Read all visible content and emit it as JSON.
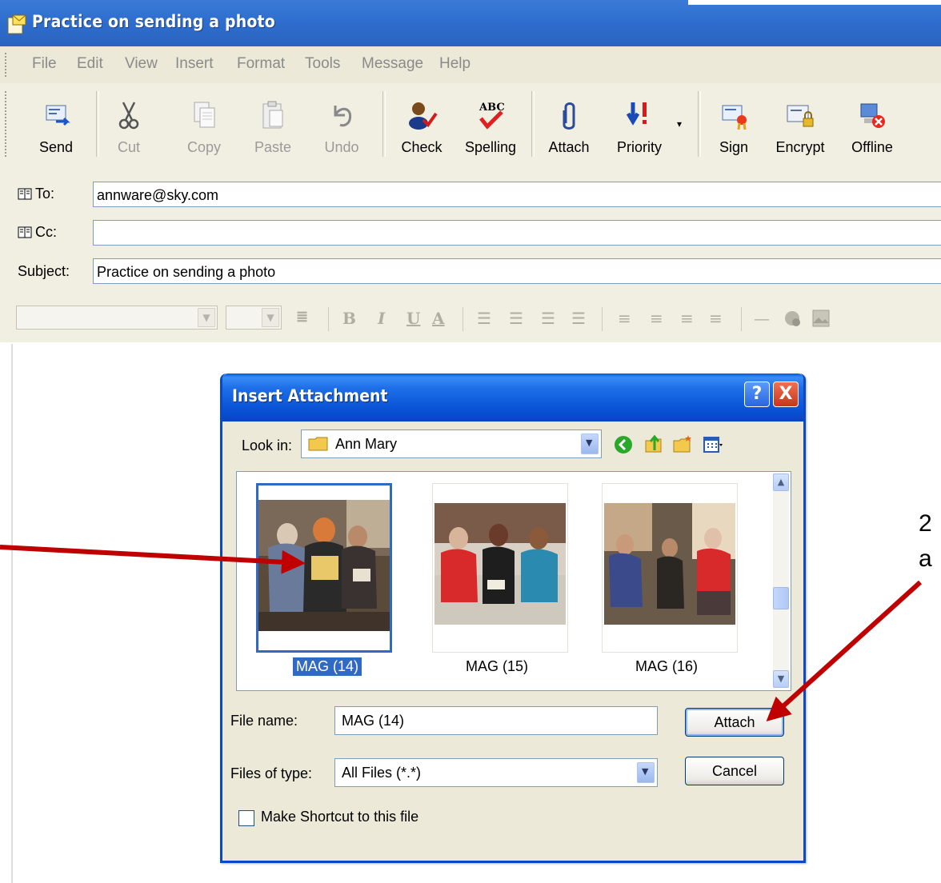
{
  "window": {
    "title": "Practice on sending a photo"
  },
  "menu": [
    "File",
    "Edit",
    "View",
    "Insert",
    "Format",
    "Tools",
    "Message",
    "Help"
  ],
  "toolbar": {
    "send": "Send",
    "cut": "Cut",
    "copy": "Copy",
    "paste": "Paste",
    "undo": "Undo",
    "check": "Check",
    "spelling": "Spelling",
    "attach": "Attach",
    "priority": "Priority",
    "sign": "Sign",
    "encrypt": "Encrypt",
    "offline": "Offline"
  },
  "fields": {
    "to_label": "To:",
    "to_value": "annware@sky.com",
    "cc_label": "Cc:",
    "cc_value": "",
    "subject_label": "Subject:",
    "subject_value": "Practice on sending a photo"
  },
  "dialog": {
    "title": "Insert Attachment",
    "help": "?",
    "close": "X",
    "look_in_label": "Look in:",
    "look_in_value": "Ann Mary",
    "files": [
      {
        "name": "MAG (14)",
        "selected": true
      },
      {
        "name": "MAG (15)",
        "selected": false
      },
      {
        "name": "MAG (16)",
        "selected": false
      }
    ],
    "file_name_label": "File name:",
    "file_name_value": "MAG (14)",
    "files_of_type_label": "Files of type:",
    "files_of_type_value": "All Files (*.*)",
    "attach_button": "Attach",
    "cancel_button": "Cancel",
    "shortcut_label": "Make Shortcut to this file"
  },
  "annotations": {
    "right_line1": "2",
    "right_line2": "a"
  },
  "colors": {
    "title_blue": "#2f6fcf",
    "dialog_blue": "#0a55d8",
    "arrow_red": "#c00000",
    "selection": "#316ac5"
  }
}
